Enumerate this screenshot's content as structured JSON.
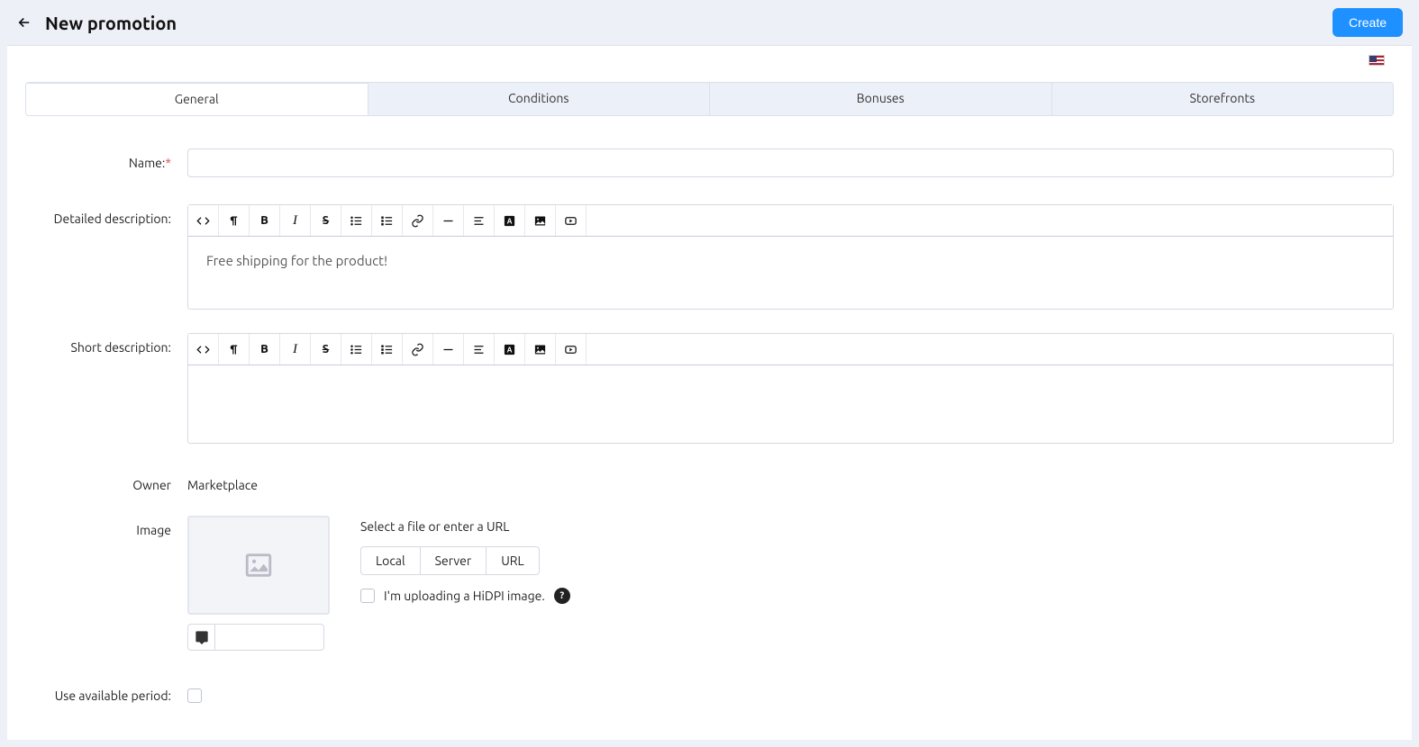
{
  "header": {
    "title": "New promotion",
    "create_label": "Create"
  },
  "tabs": [
    "General",
    "Conditions",
    "Bonuses",
    "Storefronts"
  ],
  "labels": {
    "name": "Name:",
    "detailed": "Detailed description:",
    "short": "Short description:",
    "owner": "Owner",
    "image": "Image",
    "use_period": "Use available period:"
  },
  "fields": {
    "name_value": "",
    "detailed_value": "Free shipping for the product!",
    "short_value": "",
    "owner_value": "Marketplace",
    "image_alt_value": ""
  },
  "image": {
    "select_hint": "Select a file or enter a URL",
    "local": "Local",
    "server": "Server",
    "url": "URL",
    "hidpi_label": "I'm uploading a HiDPI image.",
    "help_char": "?"
  },
  "toolbar_icons": [
    "code",
    "paragraph",
    "bold",
    "italic",
    "strike",
    "ul",
    "ol",
    "link",
    "hr",
    "align",
    "textcolor",
    "image",
    "media"
  ]
}
